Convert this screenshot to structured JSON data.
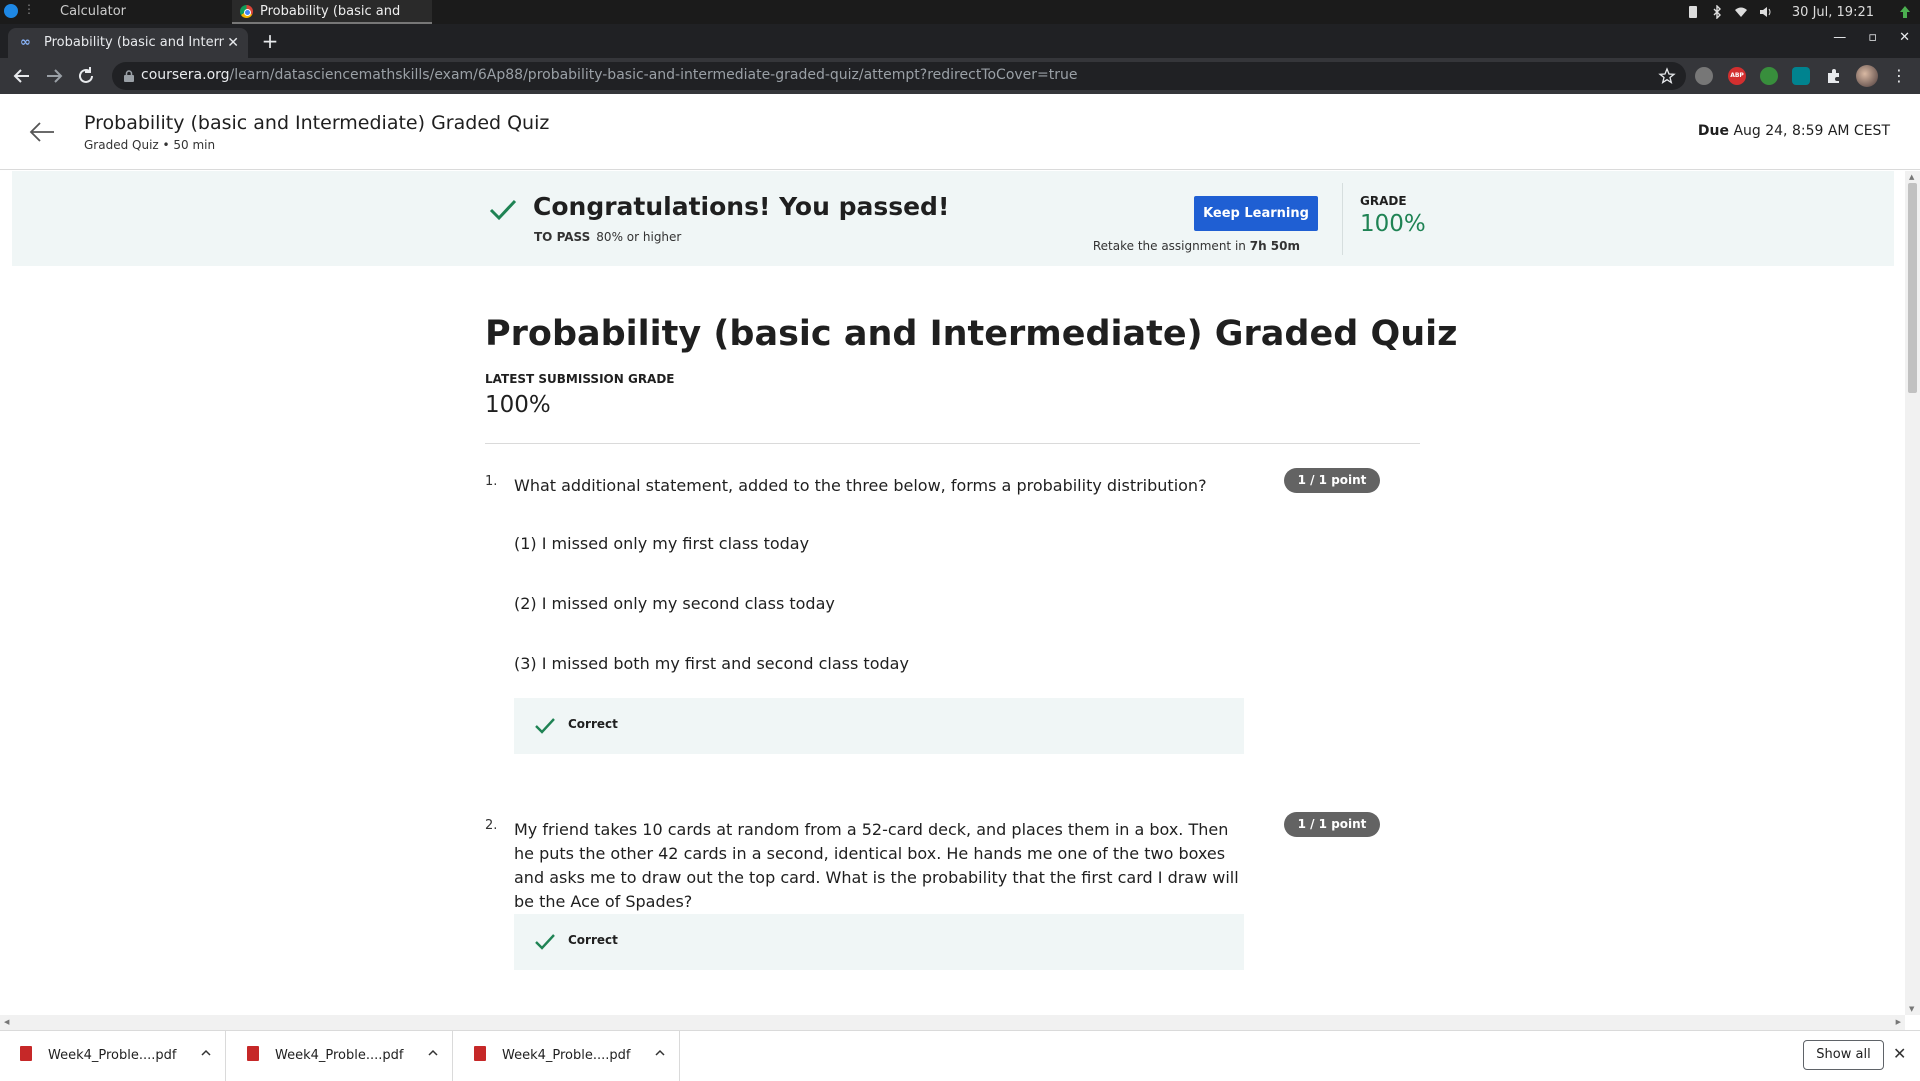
{
  "os": {
    "tasks": [
      "Calculator",
      "Probability (basic and Inte…"
    ],
    "clock": "30 Jul, 19:21"
  },
  "browser": {
    "tab_title": "Probability (basic and Interme",
    "url_host": "coursera.org",
    "url_path": "/learn/datasciencemathskills/exam/6Ap88/probability-basic-and-intermediate-graded-quiz/attempt?redirectToCover=true",
    "ext_abp": "ABP"
  },
  "header": {
    "title": "Probability (basic and Intermediate) Graded Quiz",
    "subtitle": "Graded Quiz • 50 min",
    "due_label": "Due",
    "due_value": "Aug 24, 8:59 AM CEST"
  },
  "banner": {
    "title": "Congratulations! You passed!",
    "to_pass_label": "TO PASS",
    "to_pass_value": "80% or higher",
    "button": "Keep Learning",
    "retake_prefix": "Retake the assignment in",
    "retake_time": "7h 50m",
    "grade_label": "GRADE",
    "grade_value": "100%",
    "success_color": "#1f8354",
    "button_color": "#1f5fd3"
  },
  "quiz": {
    "heading": "Probability (basic and Intermediate) Graded Quiz",
    "latest_label": "LATEST SUBMISSION GRADE",
    "latest_value": "100%",
    "questions": [
      {
        "number": "1.",
        "text": "What additional statement, added to the three below, forms a probability distribution?",
        "lines": [
          "(1) I missed only my first class today",
          "(2) I missed only my second class today",
          "(3) I missed both my first and second class today"
        ],
        "points": "1 / 1 point",
        "feedback": "Correct"
      },
      {
        "number": "2.",
        "text": "My friend takes 10 cards at random from a 52-card deck, and places them in a box. Then he puts the other 42 cards in a second, identical box. He hands me one of the two boxes and asks me to draw out the top card. What is the probability that the first card I draw will be the Ace of Spades?",
        "lines": [],
        "points": "1 / 1 point",
        "feedback": "Correct"
      }
    ]
  },
  "downloads": {
    "files": [
      "Week4_Proble....pdf",
      "Week4_Proble....pdf",
      "Week4_Proble....pdf"
    ],
    "show_all": "Show all"
  }
}
